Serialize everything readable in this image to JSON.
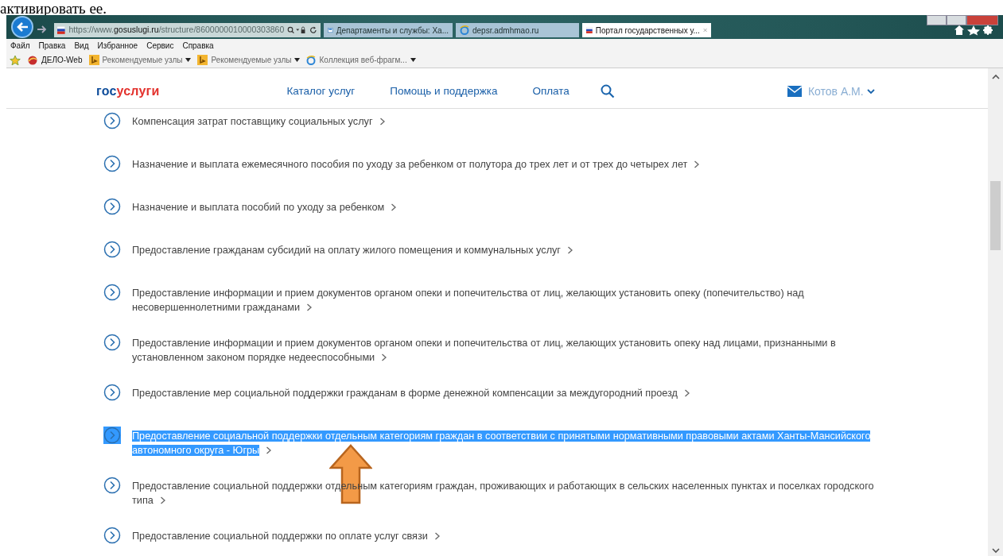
{
  "document_text": "активировать ее.",
  "browser": {
    "address": "https://www.**gosuslugi.ru**/structure/8600000010000303860",
    "tabs": [
      {
        "title": "Департаменты и службы: Ха...",
        "selected": false
      },
      {
        "title": "depsr.admhmao.ru",
        "selected": false
      },
      {
        "title": "Портал государственных у...",
        "selected": true
      }
    ],
    "menu": [
      "Файл",
      "Правка",
      "Вид",
      "Избранное",
      "Сервис",
      "Справка"
    ],
    "favorites": [
      {
        "label": "ДЕЛО-Web",
        "dropdown": false
      },
      {
        "label": "Рекомендуемые узлы",
        "dropdown": true
      },
      {
        "label": "Рекомендуемые узлы",
        "dropdown": true
      },
      {
        "label": "Коллекция веб-фрагм...",
        "dropdown": true
      }
    ]
  },
  "site": {
    "logo": [
      "гос",
      "услуги"
    ],
    "nav": [
      "Каталог услуг",
      "Помощь и поддержка",
      "Оплата"
    ],
    "user": "Котов А.М."
  },
  "services": [
    {
      "title": "Компенсация затрат поставщику социальных услуг",
      "selected": false
    },
    {
      "title": "Назначение и выплата ежемесячного пособия по уходу за ребенком от полутора до трех лет и от трех до четырех лет",
      "selected": false
    },
    {
      "title": "Назначение и выплата пособий по уходу за ребенком",
      "selected": false
    },
    {
      "title": "Предоставление гражданам субсидий на оплату жилого помещения и коммунальных услуг",
      "selected": false
    },
    {
      "title": "Предоставление информации и прием документов органом опеки и попечительства от лиц, желающих установить опеку (попечительство) над несовершеннолетними гражданами",
      "selected": false
    },
    {
      "title": "Предоставление информации и прием документов органом опеки и попечительства от лиц, желающих установить опеку над лицами, признанными в установленном законом порядке недееспособными",
      "selected": false
    },
    {
      "title": "Предоставление мер социальной поддержки гражданам в форме денежной компенсации за междугородний проезд",
      "selected": false
    },
    {
      "title": "Предоставление социальной поддержки отдельным категориям граждан в соответствии с принятыми нормативными правовыми актами Ханты-Мансийского автономного округа - Югры",
      "selected": true
    },
    {
      "title": "Предоставление социальной поддержки отдельным категориям граждан, проживающих и работающих в сельских населенных пунктах и поселках городского типа",
      "selected": false
    },
    {
      "title": "Предоставление социальной поддержки по оплате услуг связи",
      "selected": false
    }
  ]
}
